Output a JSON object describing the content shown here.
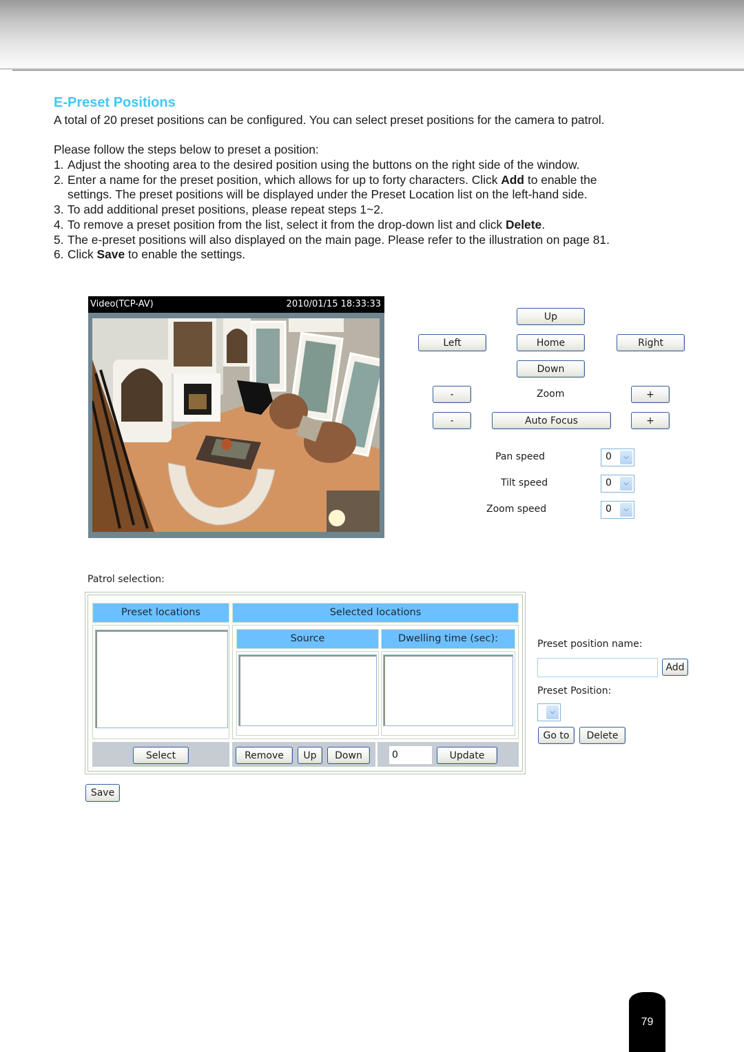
{
  "document": {
    "section_title": "E-Preset Positions",
    "intro": "A total of 20 preset positions can be configured. You can select preset positions for the camera to patrol.",
    "steps_lead": "Please follow the steps below to preset a position:",
    "steps": [
      {
        "num": "1.",
        "text": "Adjust the shooting area to the desired position using the buttons on the right side of the window."
      },
      {
        "num": "2.",
        "pre": "Enter a name for the preset position, which allows for up to forty characters. Click ",
        "bold": "Add",
        "post": " to enable the",
        "cont": "settings. The preset positions will be displayed under the Preset Location list on the left-hand side."
      },
      {
        "num": "3.",
        "text": "To add additional preset positions, please repeat steps 1~2."
      },
      {
        "num": "4.",
        "pre": "To remove a preset position from the list, select it from the drop-down list and click ",
        "bold": "Delete",
        "post": "."
      },
      {
        "num": "5.",
        "text": "The e-preset positions will also displayed on the main page. Please refer to the illustration on page 81."
      },
      {
        "num": "6.",
        "pre": "Click ",
        "bold": "Save",
        "post": " to enable the settings."
      }
    ],
    "page_number": "79"
  },
  "video": {
    "title": "Video(TCP-AV)",
    "timestamp": "2010/01/15 18:33:33",
    "image_description": "overhead view of living room with curved sofa, fireplace, piano and windows"
  },
  "ptz_controls": {
    "up": "Up",
    "left": "Left",
    "home": "Home",
    "right": "Right",
    "down": "Down",
    "zoom_out": "-",
    "zoom_label": "Zoom",
    "zoom_in": "+",
    "focus_near": "-",
    "auto_focus": "Auto Focus",
    "focus_far": "+"
  },
  "speeds": [
    {
      "label": "Pan speed",
      "value": "0"
    },
    {
      "label": "Tilt speed",
      "value": "0"
    },
    {
      "label": "Zoom speed",
      "value": "0"
    }
  ],
  "patrol": {
    "label": "Patrol selection:",
    "preset_locations_header": "Preset locations",
    "selected_locations_header": "Selected locations",
    "source_header": "Source",
    "dwelling_header": "Dwelling time (sec):",
    "select_button": "Select",
    "remove_button": "Remove",
    "up_button": "Up",
    "down_button": "Down",
    "dwelling_value": "0",
    "update_button": "Update"
  },
  "preset_form": {
    "name_label": "Preset position name:",
    "name_value": "",
    "add_button": "Add",
    "position_label": "Preset Position:",
    "position_value": "",
    "goto_button": "Go to",
    "delete_button": "Delete"
  },
  "save_button": "Save",
  "colors": {
    "title_accent": "#42c8f4",
    "table_header": "#6cc0ff",
    "button_border": "#34609e"
  }
}
